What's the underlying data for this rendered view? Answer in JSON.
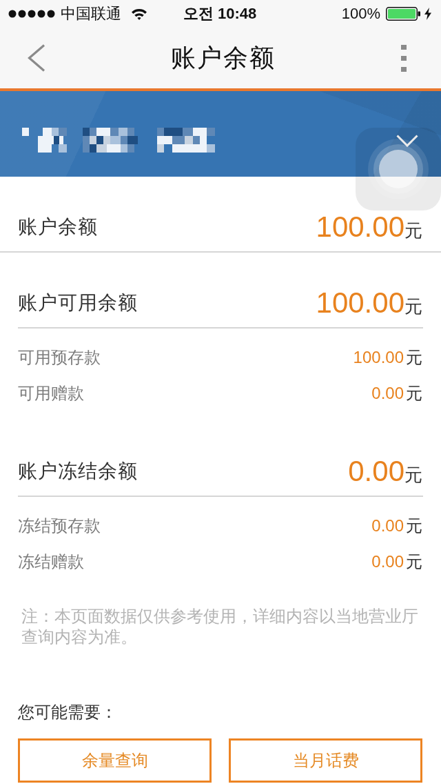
{
  "status_bar": {
    "carrier": "中国联通",
    "time": "오전 10:48",
    "battery": "100%"
  },
  "nav": {
    "title": "账户余额"
  },
  "sections": [
    {
      "label": "账户余额",
      "amount": "100.00",
      "unit": "元"
    },
    {
      "label": "账户可用余额",
      "amount": "100.00",
      "unit": "元",
      "items": [
        {
          "label": "可用预存款",
          "amount": "100.00",
          "unit": "元"
        },
        {
          "label": "可用赠款",
          "amount": "0.00",
          "unit": "元"
        }
      ]
    },
    {
      "label": "账户冻结余额",
      "amount": "0.00",
      "unit": "元",
      "items": [
        {
          "label": "冻结预存款",
          "amount": "0.00",
          "unit": "元"
        },
        {
          "label": "冻结赠款",
          "amount": "0.00",
          "unit": "元"
        }
      ]
    }
  ],
  "note": "注：本页面数据仅供参考使用，详细内容以当地营业厅查询内容为准。",
  "suggestions": {
    "title": "您可能需要：",
    "buttons": [
      {
        "label": "余量查询"
      },
      {
        "label": "当月话费"
      }
    ]
  }
}
